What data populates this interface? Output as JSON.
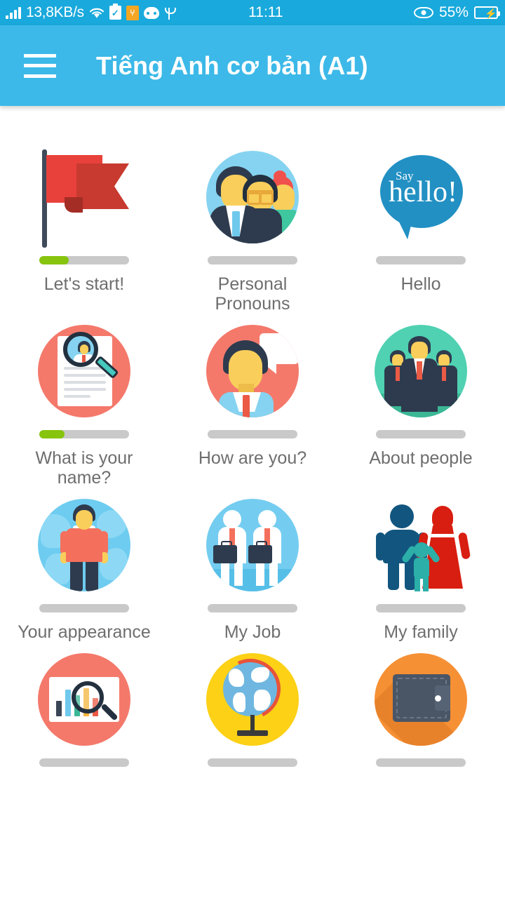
{
  "status_bar": {
    "signal_icon": "signal-bars-icon",
    "network_speed": "13,8KB/s",
    "wifi_icon": "wifi-icon",
    "clipboard_icon": "clipboard-check-icon",
    "tools_icon": "tools-icon",
    "robot_icon": "android-robot-icon",
    "usb_icon": "usb-icon",
    "clock": "11:11",
    "eye_icon": "eye-care-icon",
    "battery_percent": "55%",
    "battery_icon": "battery-charging-icon",
    "bg_color": "#19A9DC"
  },
  "app_bar": {
    "menu_icon": "hamburger-menu-icon",
    "title": "Tiếng Anh cơ bản (A1)",
    "bg_color": "#3CB9E8",
    "title_color": "#FFFFFF"
  },
  "theme": {
    "progress_fill": "#86C40D",
    "progress_track": "#C9C9C9",
    "label_color": "#6E6E6E",
    "page_bg": "#FFFFFF"
  },
  "lessons": [
    {
      "label": "Let's start!",
      "icon": "red-flag-icon",
      "progress": 33,
      "row": 1
    },
    {
      "label": "Personal\nPronouns",
      "icon": "three-people-icon",
      "progress": 0,
      "row": 1
    },
    {
      "label": "Hello",
      "icon": "say-hello-bubble-icon",
      "progress": 0,
      "row": 1,
      "art_text": {
        "small": "Say",
        "big": "hello!"
      }
    },
    {
      "label": "What is your\nname?",
      "icon": "resume-magnifier-icon",
      "progress": 28,
      "row": 2
    },
    {
      "label": "How are you?",
      "icon": "person-speech-bubble-icon",
      "progress": 0,
      "row": 2
    },
    {
      "label": "About people",
      "icon": "three-businessmen-icon",
      "progress": 0,
      "row": 2
    },
    {
      "label": "Your appearance",
      "icon": "man-globe-icon",
      "progress": 0,
      "row": 3
    },
    {
      "label": "My Job",
      "icon": "two-businessmen-briefcase-icon",
      "progress": 0,
      "row": 3
    },
    {
      "label": "My family",
      "icon": "family-icon",
      "progress": 0,
      "row": 3
    },
    {
      "label": "",
      "icon": "chart-magnifier-icon",
      "progress": 0,
      "row": 4
    },
    {
      "label": "",
      "icon": "desk-globe-icon",
      "progress": 0,
      "row": 4
    },
    {
      "label": "",
      "icon": "wallet-icon",
      "progress": 0,
      "row": 4
    }
  ]
}
